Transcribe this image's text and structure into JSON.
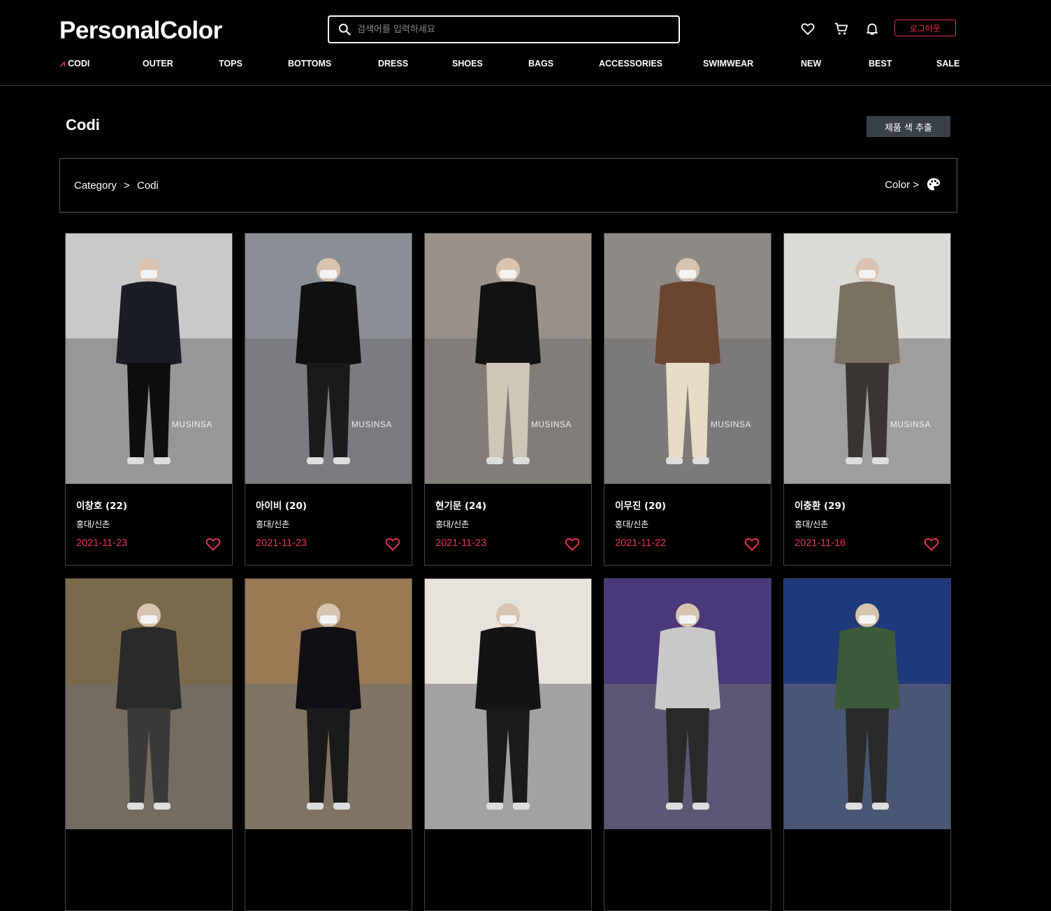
{
  "header": {
    "logo": "PersonalColor",
    "search_placeholder": "검색어를 입력하세요",
    "logout_label": "로그아웃",
    "icons": [
      "heart-icon",
      "cart-icon",
      "bell-icon"
    ]
  },
  "nav": [
    {
      "label": "CODI",
      "active": true
    },
    {
      "label": "OUTER"
    },
    {
      "label": "TOPS"
    },
    {
      "label": "BOTTOMS"
    },
    {
      "label": "DRESS"
    },
    {
      "label": "SHOES"
    },
    {
      "label": "BAGS"
    },
    {
      "label": "ACCESSORIES"
    },
    {
      "label": "SWIMWEAR"
    },
    {
      "label": "NEW"
    },
    {
      "label": "BEST"
    },
    {
      "label": "SALE"
    }
  ],
  "page": {
    "title": "Codi",
    "extract_button": "제품 색 추출",
    "breadcrumb": [
      "Category",
      ">",
      "Codi"
    ],
    "color_label": "Color >"
  },
  "cards": [
    {
      "name": "이창호 (22)",
      "location": "홍대/신촌",
      "date": "2021-11-23",
      "watermark": "MUSINSA",
      "palette": [
        "#c9c9c9",
        "#1a1d24",
        "#0e0e10"
      ]
    },
    {
      "name": "아이비 (20)",
      "location": "홍대/신촌",
      "date": "2021-11-23",
      "watermark": "MUSINSA",
      "palette": [
        "#8a8f96",
        "#101010",
        "#1a1a1a"
      ]
    },
    {
      "name": "현기문 (24)",
      "location": "홍대/신촌",
      "date": "2021-11-23",
      "watermark": "MUSINSA",
      "palette": [
        "#9a9288",
        "#121212",
        "#cfc6b8"
      ]
    },
    {
      "name": "이무진 (20)",
      "location": "홍대/신촌",
      "date": "2021-11-22",
      "watermark": "MUSINSA",
      "palette": [
        "#8d8a86",
        "#6a4530",
        "#e8dcc6"
      ]
    },
    {
      "name": "이충환 (29)",
      "location": "홍대/신촌",
      "date": "2021-11-16",
      "watermark": "MUSINSA",
      "palette": [
        "#d9d9d6",
        "#7a7163",
        "#3a3530"
      ]
    },
    {
      "name": "",
      "location": "",
      "date": "",
      "watermark": "",
      "palette": [
        "#7a6a4c",
        "#2a2a2a",
        "#3a3a3a"
      ]
    },
    {
      "name": "",
      "location": "",
      "date": "",
      "watermark": "",
      "palette": [
        "#9a7a55",
        "#0f0f14",
        "#1a1a1a"
      ]
    },
    {
      "name": "",
      "location": "",
      "date": "",
      "watermark": "",
      "palette": [
        "#e6e2dc",
        "#141414",
        "#1a1a1a"
      ]
    },
    {
      "name": "",
      "location": "",
      "date": "",
      "watermark": "",
      "palette": [
        "#4a3a7a",
        "#c8c8c8",
        "#2a2a2a"
      ]
    },
    {
      "name": "",
      "location": "",
      "date": "",
      "watermark": "",
      "palette": [
        "#1e3b7a",
        "#3c5a3a",
        "#2a2a2a"
      ]
    }
  ],
  "colors": {
    "accent": "#e3344f",
    "button": "#3a4049"
  }
}
